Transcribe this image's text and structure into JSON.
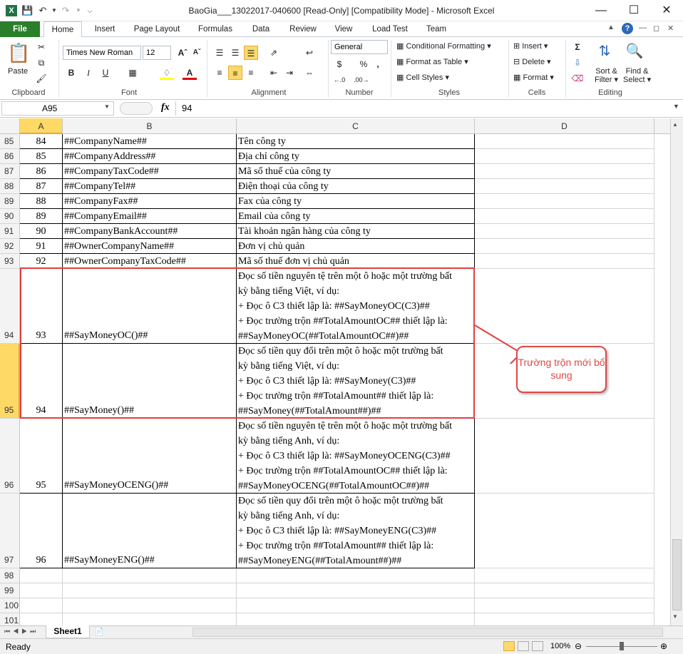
{
  "window": {
    "title": "BaoGia___13022017-040600  [Read-Only]  [Compatibility Mode]  -  Microsoft Excel"
  },
  "tabs": [
    "File",
    "Home",
    "Insert",
    "Page Layout",
    "Formulas",
    "Data",
    "Review",
    "View",
    "Load Test",
    "Team"
  ],
  "ribbon": {
    "clipboard": {
      "paste": "Paste",
      "label": "Clipboard"
    },
    "font": {
      "name": "Times New Roman",
      "size": "12",
      "label": "Font"
    },
    "alignment": {
      "label": "Alignment"
    },
    "number": {
      "format": "General",
      "currency": "$",
      "percent": "%",
      "comma": ",",
      "label": "Number"
    },
    "styles": {
      "conditional": "Conditional Formatting",
      "table": "Format as Table",
      "cell": "Cell Styles",
      "label": "Styles"
    },
    "cells": {
      "insert": "Insert",
      "delete": "Delete",
      "format": "Format",
      "label": "Cells"
    },
    "editing": {
      "sort": "Sort &",
      "sort2": "Filter",
      "find": "Find &",
      "find2": "Select",
      "label": "Editing"
    }
  },
  "formula_bar": {
    "name_box": "A95",
    "fx": "fx",
    "value": "94"
  },
  "columns": [
    "A",
    "B",
    "C",
    "D"
  ],
  "rows": [
    {
      "row": "85",
      "a": "84",
      "b": "##CompanyName##",
      "c": "Tên công ty"
    },
    {
      "row": "86",
      "a": "85",
      "b": "##CompanyAddress##",
      "c": "Địa chỉ công ty"
    },
    {
      "row": "87",
      "a": "86",
      "b": "##CompanyTaxCode##",
      "c": "Mã số thuế của công ty"
    },
    {
      "row": "88",
      "a": "87",
      "b": "##CompanyTel##",
      "c": "Điện thoại của công ty"
    },
    {
      "row": "89",
      "a": "88",
      "b": "##CompanyFax##",
      "c": "Fax của công ty"
    },
    {
      "row": "90",
      "a": "89",
      "b": "##CompanyEmail##",
      "c": "Email của công ty"
    },
    {
      "row": "91",
      "a": "90",
      "b": "##CompanyBankAccount##",
      "c": "Tài khoản ngân hàng của công ty"
    },
    {
      "row": "92",
      "a": "91",
      "b": "##OwnerCompanyName##",
      "c": "Đơn vị chủ quản"
    },
    {
      "row": "93",
      "a": "92",
      "b": "##OwnerCompanyTaxCode##",
      "c": "Mã số thuế đơn vị chủ quản"
    },
    {
      "row": "94",
      "a": "93",
      "b": "##SayMoneyOC()##",
      "c": [
        "Đọc số tiền nguyên tệ trên một ô hoặc một trường bất",
        "kỳ bằng tiếng Việt, ví dụ:",
        "+ Đọc ô C3 thiết lập là: ##SayMoneyOC(C3)##",
        "+ Đọc trường trộn ##TotalAmountOC## thiết lập là:",
        "##SayMoneyOC(##TotalAmountOC##)##"
      ]
    },
    {
      "row": "95",
      "a": "94",
      "b": "##SayMoney()##",
      "c": [
        "Đọc số tiền quy đổi trên một ô hoặc một trường bất",
        "kỳ bằng tiếng Việt, ví dụ:",
        "+ Đọc ô C3 thiết lập là: ##SayMoney(C3)##",
        "+ Đọc trường trộn ##TotalAmount## thiết lập là:",
        "##SayMoney(##TotalAmount##)##"
      ]
    },
    {
      "row": "96",
      "a": "95",
      "b": "##SayMoneyOCENG()##",
      "c": [
        "Đọc số tiền nguyên tệ trên một ô hoặc một trường bất",
        "kỳ bằng tiếng Anh, ví dụ:",
        "+ Đọc ô C3 thiết lập là: ##SayMoneyOCENG(C3)##",
        "+ Đọc trường trộn ##TotalAmountOC## thiết lập là:",
        "##SayMoneyOCENG(##TotalAmountOC##)##"
      ]
    },
    {
      "row": "97",
      "a": "96",
      "b": "##SayMoneyENG()##",
      "c": [
        "Đọc số tiền quy đổi trên một ô hoặc một trường bất",
        "kỳ bằng tiếng Anh, ví dụ:",
        "+ Đọc ô C3 thiết lập là: ##SayMoneyENG(C3)##",
        "+ Đọc trường trộn ##TotalAmount## thiết lập là:",
        "##SayMoneyENG(##TotalAmount##)##"
      ]
    },
    {
      "row": "98",
      "a": "",
      "b": "",
      "c": ""
    },
    {
      "row": "99",
      "a": "",
      "b": "",
      "c": ""
    },
    {
      "row": "100",
      "a": "",
      "b": "",
      "c": ""
    },
    {
      "row": "101",
      "a": "",
      "b": "",
      "c": ""
    }
  ],
  "annotation": {
    "callout": "Trường trộn mới bổ sung"
  },
  "sheet_tab": "Sheet1",
  "status": {
    "ready": "Ready",
    "zoom": "100%"
  },
  "colors": {
    "file_tab": "#2a7f2a",
    "highlight": "#e04040",
    "selected_row": "#ffd966"
  }
}
